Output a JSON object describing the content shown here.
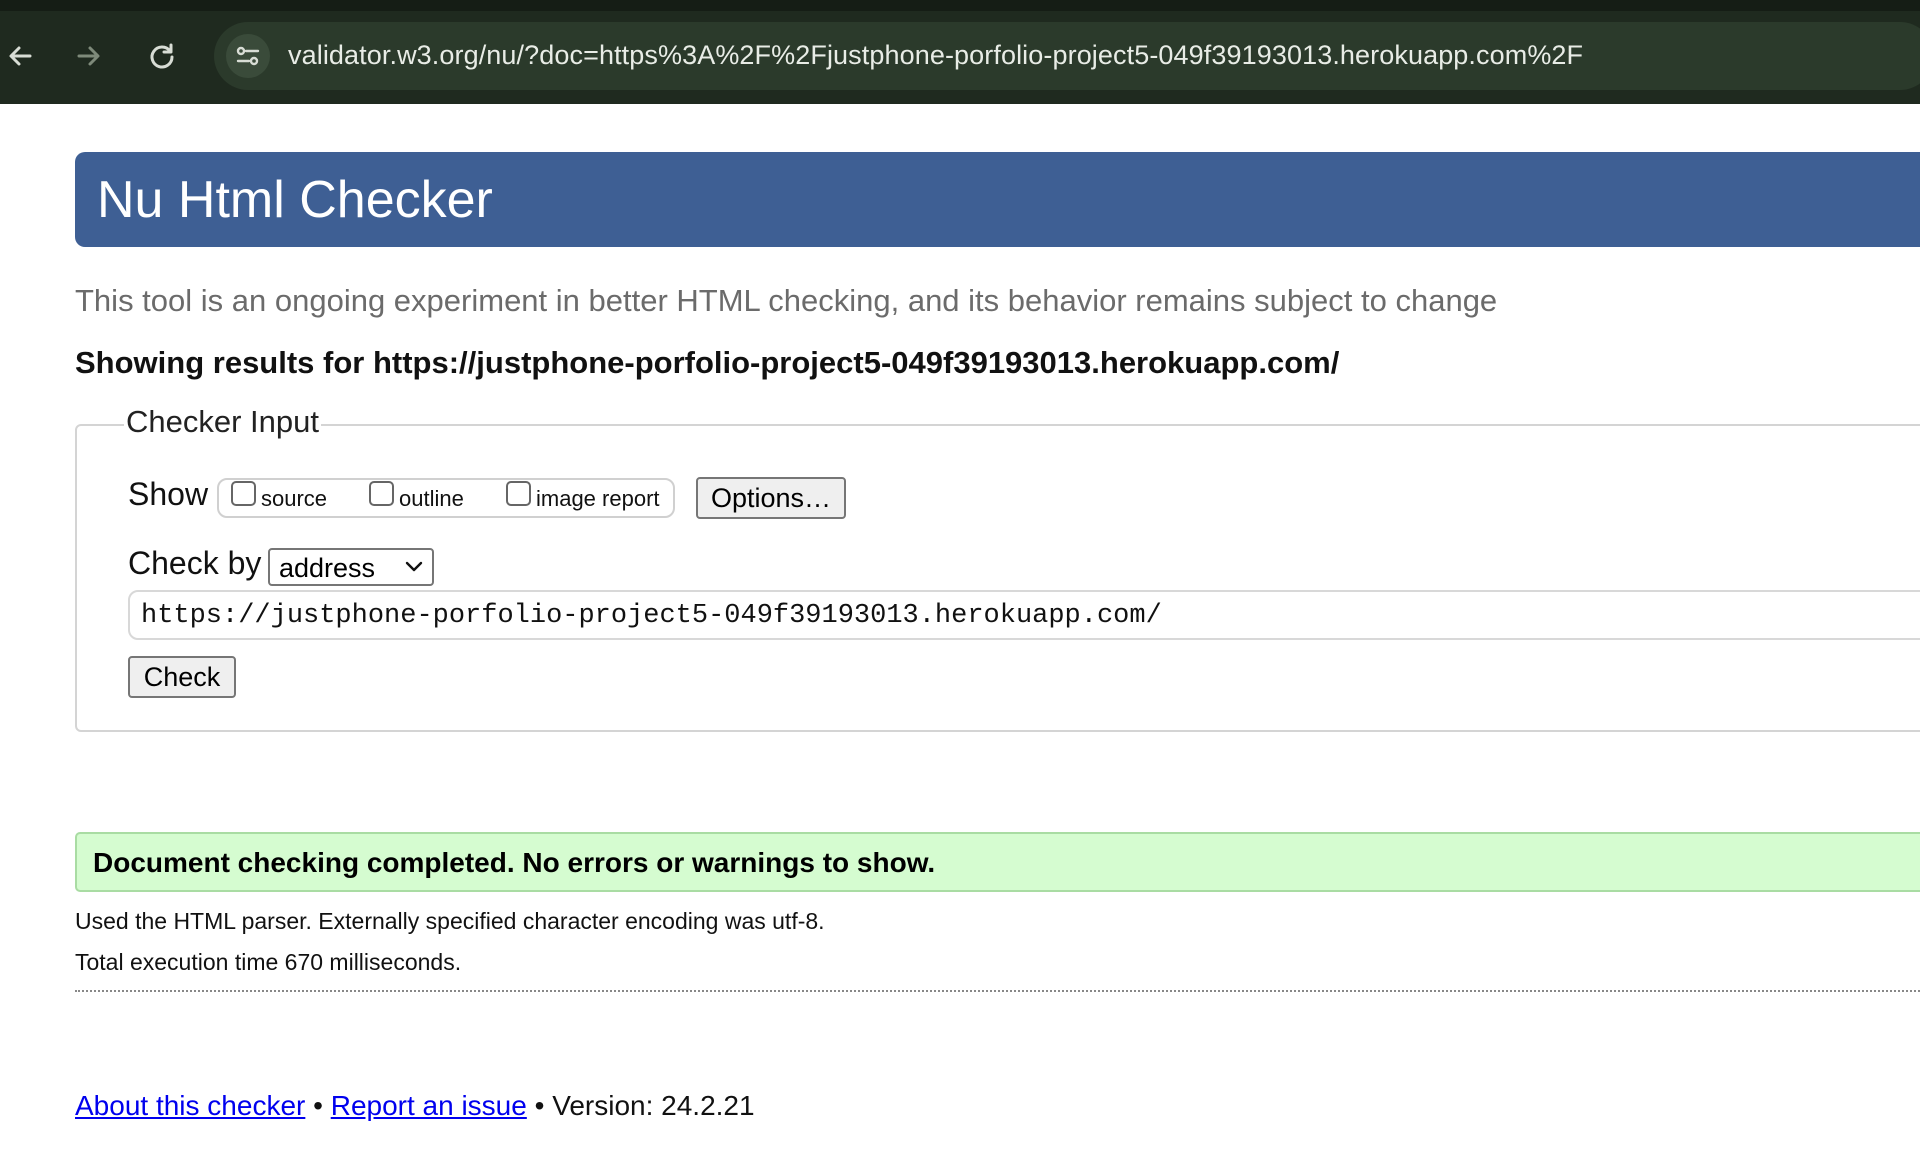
{
  "browser": {
    "url": "validator.w3.org/nu/?doc=https%3A%2F%2Fjustphone-porfolio-project5-049f39193013.herokuapp.com%2F",
    "chrome_bg": "#1f2a1f",
    "icons": [
      "back-arrow-icon",
      "forward-arrow-icon",
      "reload-icon",
      "site-settings-icon"
    ]
  },
  "header": {
    "title": "Nu Html Checker",
    "accent": "#3e5f94"
  },
  "tagline": "This tool is an ongoing experiment in better HTML checking, and its behavior remains subject to change",
  "results_for": "Showing results for https://justphone-porfolio-project5-049f39193013.herokuapp.com/",
  "checker_input": {
    "legend": "Checker Input",
    "show_label": "Show",
    "checkboxes": [
      {
        "label": "source",
        "checked": false
      },
      {
        "label": "outline",
        "checked": false
      },
      {
        "label": "image report",
        "checked": false
      }
    ],
    "options_button": "Options…",
    "check_by_label": "Check by",
    "check_by_selected": "address",
    "url_value": "https://justphone-porfolio-project5-049f39193013.herokuapp.com/",
    "check_button": "Check"
  },
  "result": {
    "message": "Document checking completed. No errors or warnings to show.",
    "bg": "#d5fcd0",
    "details": [
      "Used the HTML parser. Externally specified character encoding was utf-8.",
      "Total execution time 670 milliseconds."
    ]
  },
  "footer": {
    "about_link": "About this checker",
    "separator": "•",
    "report_link": "Report an issue",
    "version": "Version: 24.2.21"
  }
}
